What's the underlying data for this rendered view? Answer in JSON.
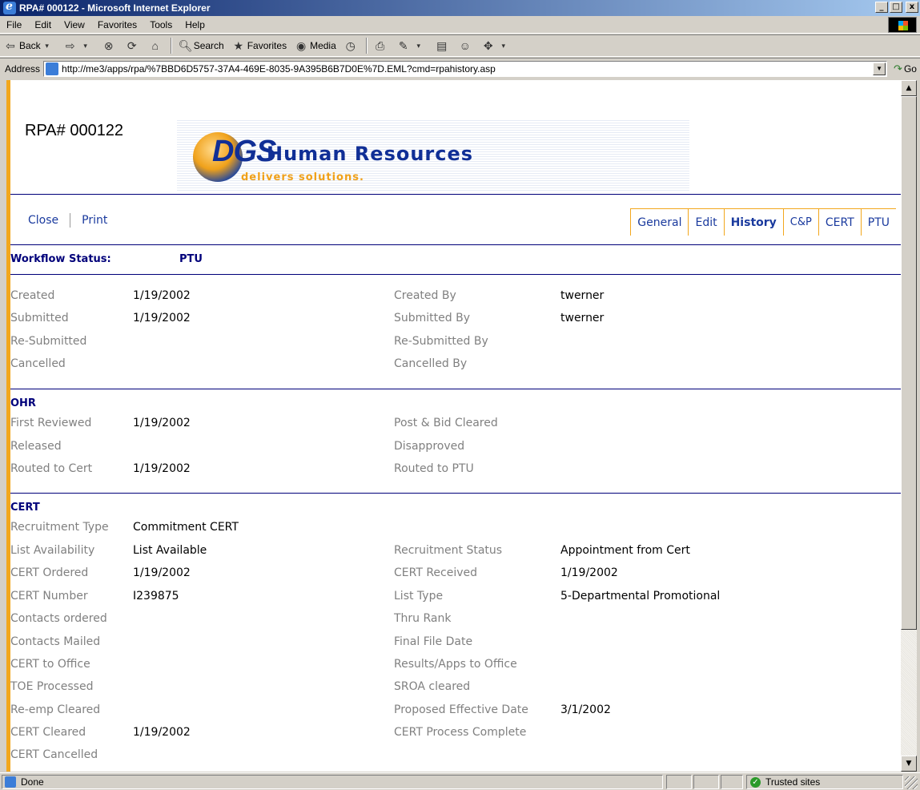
{
  "window": {
    "title": "RPA# 000122 - Microsoft Internet Explorer",
    "controls": [
      "_",
      "□",
      "x"
    ]
  },
  "menu": [
    "File",
    "Edit",
    "View",
    "Favorites",
    "Tools",
    "Help"
  ],
  "toolbar": {
    "back": "Back",
    "search": "Search",
    "favorites": "Favorites",
    "media": "Media"
  },
  "address": {
    "label": "Address",
    "url": "http://me3/apps/rpa/%7BBD6D5757-37A4-469E-8035-9A395B6B7D0E%7D.EML?cmd=rpahistory.asp",
    "go": "Go"
  },
  "page": {
    "rpa_title": "RPA# 000122",
    "logo": {
      "mark": "DGS",
      "name": "Human Resources",
      "tagline": "delivers solutions."
    },
    "links": {
      "close": "Close",
      "print": "Print"
    },
    "tabs": [
      "General",
      "Edit",
      "History",
      "C&P",
      "CERT",
      "PTU"
    ],
    "active_tab": "History",
    "workflow": {
      "label": "Workflow Status:",
      "value": "PTU"
    },
    "general": {
      "left": [
        {
          "label": "Created",
          "value": "1/19/2002"
        },
        {
          "label": "Submitted",
          "value": "1/19/2002"
        },
        {
          "label": "Re-Submitted",
          "value": ""
        },
        {
          "label": "Cancelled",
          "value": ""
        }
      ],
      "right": [
        {
          "label": "Created By",
          "value": "twerner"
        },
        {
          "label": "Submitted By",
          "value": "twerner"
        },
        {
          "label": "Re-Submitted By",
          "value": ""
        },
        {
          "label": "Cancelled By",
          "value": ""
        }
      ]
    },
    "ohr": {
      "heading": "OHR",
      "left": [
        {
          "label": "First Reviewed",
          "value": "1/19/2002"
        },
        {
          "label": "Released",
          "value": ""
        },
        {
          "label": "Routed to Cert",
          "value": "1/19/2002"
        }
      ],
      "right": [
        {
          "label": "Post & Bid Cleared",
          "value": ""
        },
        {
          "label": "Disapproved",
          "value": ""
        },
        {
          "label": "Routed to PTU",
          "value": ""
        }
      ]
    },
    "cert": {
      "heading": "CERT",
      "recruitment_type": {
        "label": "Recruitment Type",
        "value": "Commitment CERT"
      },
      "left": [
        {
          "label": "List Availability",
          "value": "List Available"
        },
        {
          "label": "CERT Ordered",
          "value": "1/19/2002"
        },
        {
          "label": "CERT Number",
          "value": "I239875"
        },
        {
          "label": "Contacts ordered",
          "value": ""
        },
        {
          "label": "Contacts Mailed",
          "value": ""
        },
        {
          "label": "CERT to Office",
          "value": ""
        },
        {
          "label": "TOE Processed",
          "value": ""
        },
        {
          "label": "Re-emp Cleared",
          "value": ""
        },
        {
          "label": "CERT Cleared",
          "value": "1/19/2002"
        },
        {
          "label": "CERT Cancelled",
          "value": ""
        }
      ],
      "right": [
        {
          "label": "Recruitment Status",
          "value": "Appointment from Cert"
        },
        {
          "label": "CERT Received",
          "value": "1/19/2002"
        },
        {
          "label": "List Type",
          "value": "5-Departmental Promotional"
        },
        {
          "label": "Thru Rank",
          "value": ""
        },
        {
          "label": "Final File Date",
          "value": ""
        },
        {
          "label": "Results/Apps to Office",
          "value": ""
        },
        {
          "label": "SROA cleared",
          "value": ""
        },
        {
          "label": "Proposed Effective Date",
          "value": "3/1/2002"
        },
        {
          "label": "CERT Process Complete",
          "value": ""
        }
      ]
    }
  },
  "status": {
    "text": "Done",
    "zone": "Trusted sites"
  }
}
